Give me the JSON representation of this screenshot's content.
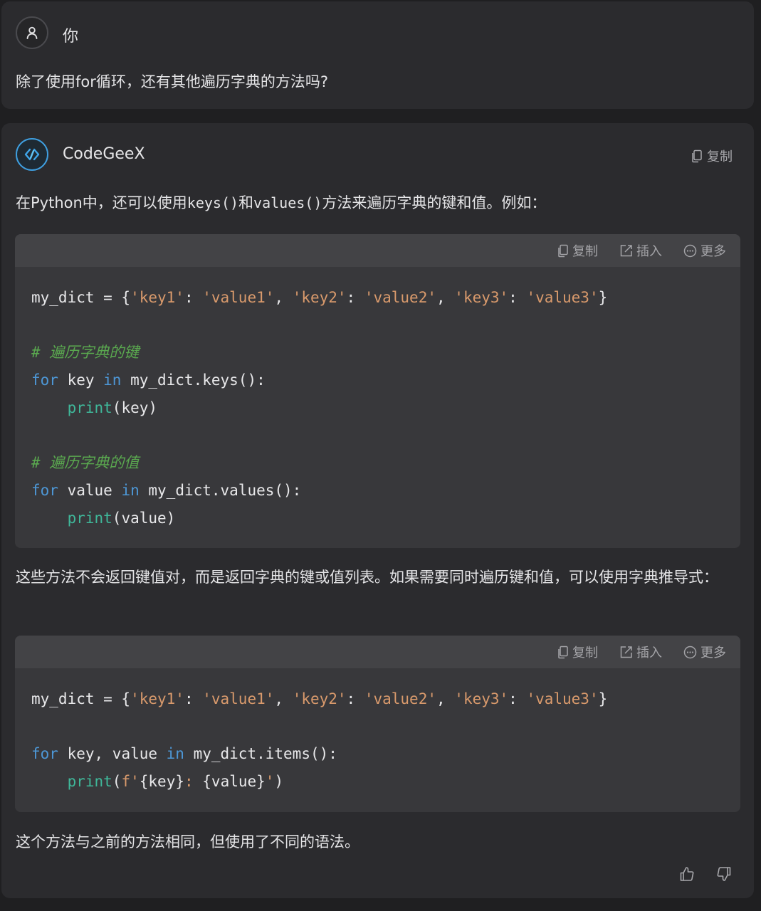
{
  "user_message": {
    "speaker": "你",
    "avatar_icon": "user-icon",
    "text": "除了使用for循环，还有其他遍历字典的方法吗?"
  },
  "assistant_message": {
    "speaker": "CodeGeeX",
    "avatar_icon": "codegeex-logo-icon",
    "copy_label": "复制",
    "intro": {
      "part1": "在Python中，还可以使用",
      "code1": "keys()",
      "part2": "和",
      "code2": "values()",
      "part3": "方法来遍历字典的键和值。例如："
    },
    "middle": "这些方法不会返回键值对，而是返回字典的键或值列表。如果需要同时遍历键和值，可以使用字典推导式：",
    "closing": "这个方法与之前的方法相同，但使用了不同的语法。",
    "feedback": {
      "like_icon": "thumbs-up-icon",
      "dislike_icon": "thumbs-down-icon"
    }
  },
  "code_toolbar": {
    "copy": "复制",
    "insert": "插入",
    "more": "更多"
  },
  "code_blocks": [
    {
      "language": "python",
      "lines": [
        "my_dict = {'key1': 'value1', 'key2': 'value2', 'key3': 'value3'}",
        "",
        "# 遍历字典的键",
        "for key in my_dict.keys():",
        "    print(key)",
        "",
        "# 遍历字典的值",
        "for value in my_dict.values():",
        "    print(value)"
      ]
    },
    {
      "language": "python",
      "lines": [
        "my_dict = {'key1': 'value1', 'key2': 'value2', 'key3': 'value3'}",
        "",
        "for key, value in my_dict.items():",
        "    print(f'{key}: {value}')"
      ]
    }
  ],
  "colors": {
    "background": "#1f1f21",
    "card": "#2b2b2e",
    "code_bg": "#38383b",
    "keyword": "#4d97d6",
    "builtin": "#3fb89a",
    "string": "#d99a6c",
    "comment": "#5aa84f",
    "brand": "#3f9fe0"
  }
}
